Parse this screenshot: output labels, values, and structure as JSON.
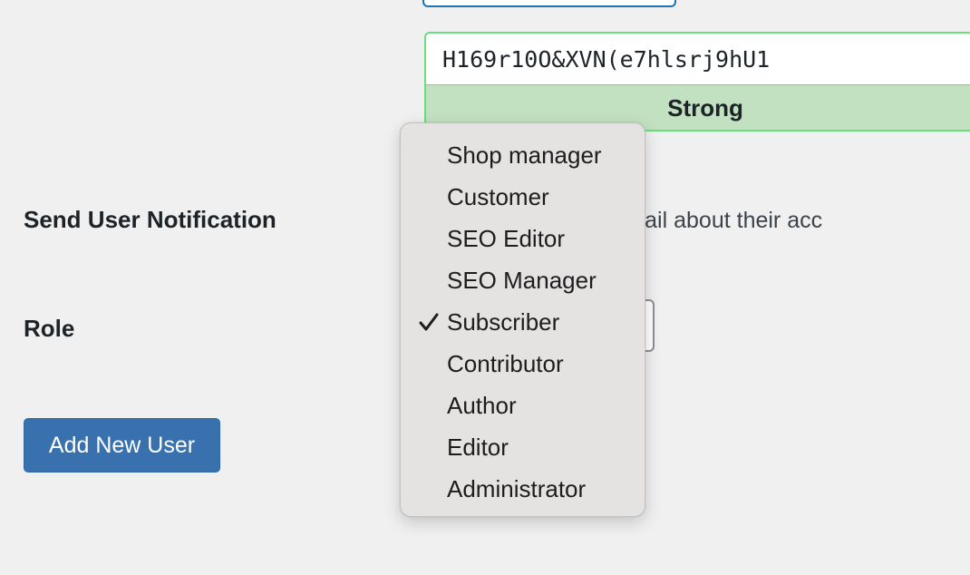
{
  "password": {
    "value": "H169r10O&XVN(e7hlsrj9hU1",
    "strength": "Strong"
  },
  "notification": {
    "label": "Send User Notification",
    "text": "ser an email about their acc"
  },
  "role": {
    "label": "Role",
    "selected": "Subscriber",
    "options": [
      {
        "label": "Shop manager",
        "checked": false
      },
      {
        "label": "Customer",
        "checked": false
      },
      {
        "label": "SEO Editor",
        "checked": false
      },
      {
        "label": "SEO Manager",
        "checked": false
      },
      {
        "label": "Subscriber",
        "checked": true
      },
      {
        "label": "Contributor",
        "checked": false
      },
      {
        "label": "Author",
        "checked": false
      },
      {
        "label": "Editor",
        "checked": false
      },
      {
        "label": "Administrator",
        "checked": false
      }
    ]
  },
  "actions": {
    "add_user_label": "Add New User"
  },
  "colors": {
    "button": "#3871ae",
    "strength_bg": "#c1e1c1",
    "strength_border": "#68de7c"
  },
  "icons": {
    "check": "check-icon"
  }
}
